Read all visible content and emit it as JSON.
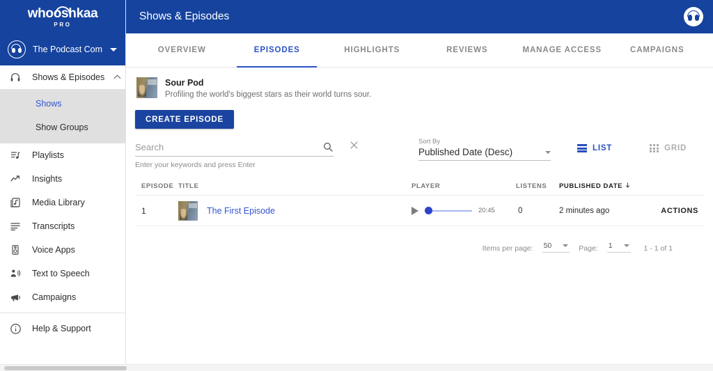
{
  "brand": {
    "name": "whooshkaa",
    "tier": "PRO",
    "logo_icon": "headphones-icon"
  },
  "org": {
    "name": "The Podcast Com...",
    "caret_icon": "caret-down-icon",
    "logo_icon": "headphones-circle-icon"
  },
  "sidebar": {
    "items": [
      {
        "label": "Shows & Episodes",
        "icon": "headphones-icon",
        "expanded": true
      },
      {
        "label": "Playlists",
        "icon": "playlist-icon"
      },
      {
        "label": "Insights",
        "icon": "trending-up-icon"
      },
      {
        "label": "Media Library",
        "icon": "media-library-icon"
      },
      {
        "label": "Transcripts",
        "icon": "transcript-lines-icon"
      },
      {
        "label": "Voice Apps",
        "icon": "speaker-icon"
      },
      {
        "label": "Text to Speech",
        "icon": "person-speaking-icon"
      },
      {
        "label": "Campaigns",
        "icon": "megaphone-icon"
      },
      {
        "label": "Help & Support",
        "icon": "info-circle-icon"
      }
    ],
    "submenu": [
      {
        "label": "Shows",
        "active": true
      },
      {
        "label": "Show Groups",
        "active": false
      }
    ]
  },
  "topbar": {
    "title": "Shows & Episodes",
    "avatar_icon": "headphones-avatar-icon"
  },
  "tabs": [
    {
      "label": "OVERVIEW",
      "active": false
    },
    {
      "label": "EPISODES",
      "active": true
    },
    {
      "label": "HIGHLIGHTS",
      "active": false
    },
    {
      "label": "REVIEWS",
      "active": false
    },
    {
      "label": "MANAGE ACCESS",
      "active": false
    },
    {
      "label": "CAMPAIGNS",
      "active": false
    }
  ],
  "show": {
    "title": "Sour Pod",
    "description": "Profiling the world's biggest stars as their world turns sour.",
    "thumbnail_name": "show-artwork"
  },
  "create_button": {
    "label": "CREATE EPISODE"
  },
  "search": {
    "placeholder": "Search",
    "value": "",
    "hint": "Enter your keywords and press Enter",
    "search_icon": "search-icon",
    "clear_icon": "close-icon"
  },
  "sort": {
    "label": "Sort By",
    "value": "Published Date (Desc)",
    "caret_icon": "caret-down-icon"
  },
  "view": {
    "list": {
      "label": "LIST",
      "active": true,
      "icon": "list-view-icon"
    },
    "grid": {
      "label": "GRID",
      "active": false,
      "icon": "grid-view-icon"
    }
  },
  "table": {
    "headers": {
      "episode": "EPISODE",
      "title": "TITLE",
      "player": "PLAYER",
      "listens": "LISTENS",
      "published_date": "PUBLISHED DATE",
      "sort_arrow_icon": "arrow-down-icon"
    },
    "rows": [
      {
        "episode": "1",
        "title": "The First Episode",
        "duration": "20:45",
        "listens": "0",
        "published_date": "2 minutes ago",
        "actions_label": "ACTIONS",
        "play_icon": "play-icon",
        "progress_percent": 0
      }
    ]
  },
  "paginator": {
    "items_per_page_label": "Items per page:",
    "items_per_page_value": "50",
    "page_label": "Page:",
    "page_value": "1",
    "range": "1 - 1 of 1",
    "caret_icon": "caret-down-icon"
  },
  "colors": {
    "brand_blue": "#15439e",
    "button_blue": "#1b44a0",
    "accent_link": "#3355d1",
    "tab_active": "#2a53c4",
    "submenu_bg": "#e0e0e0"
  }
}
